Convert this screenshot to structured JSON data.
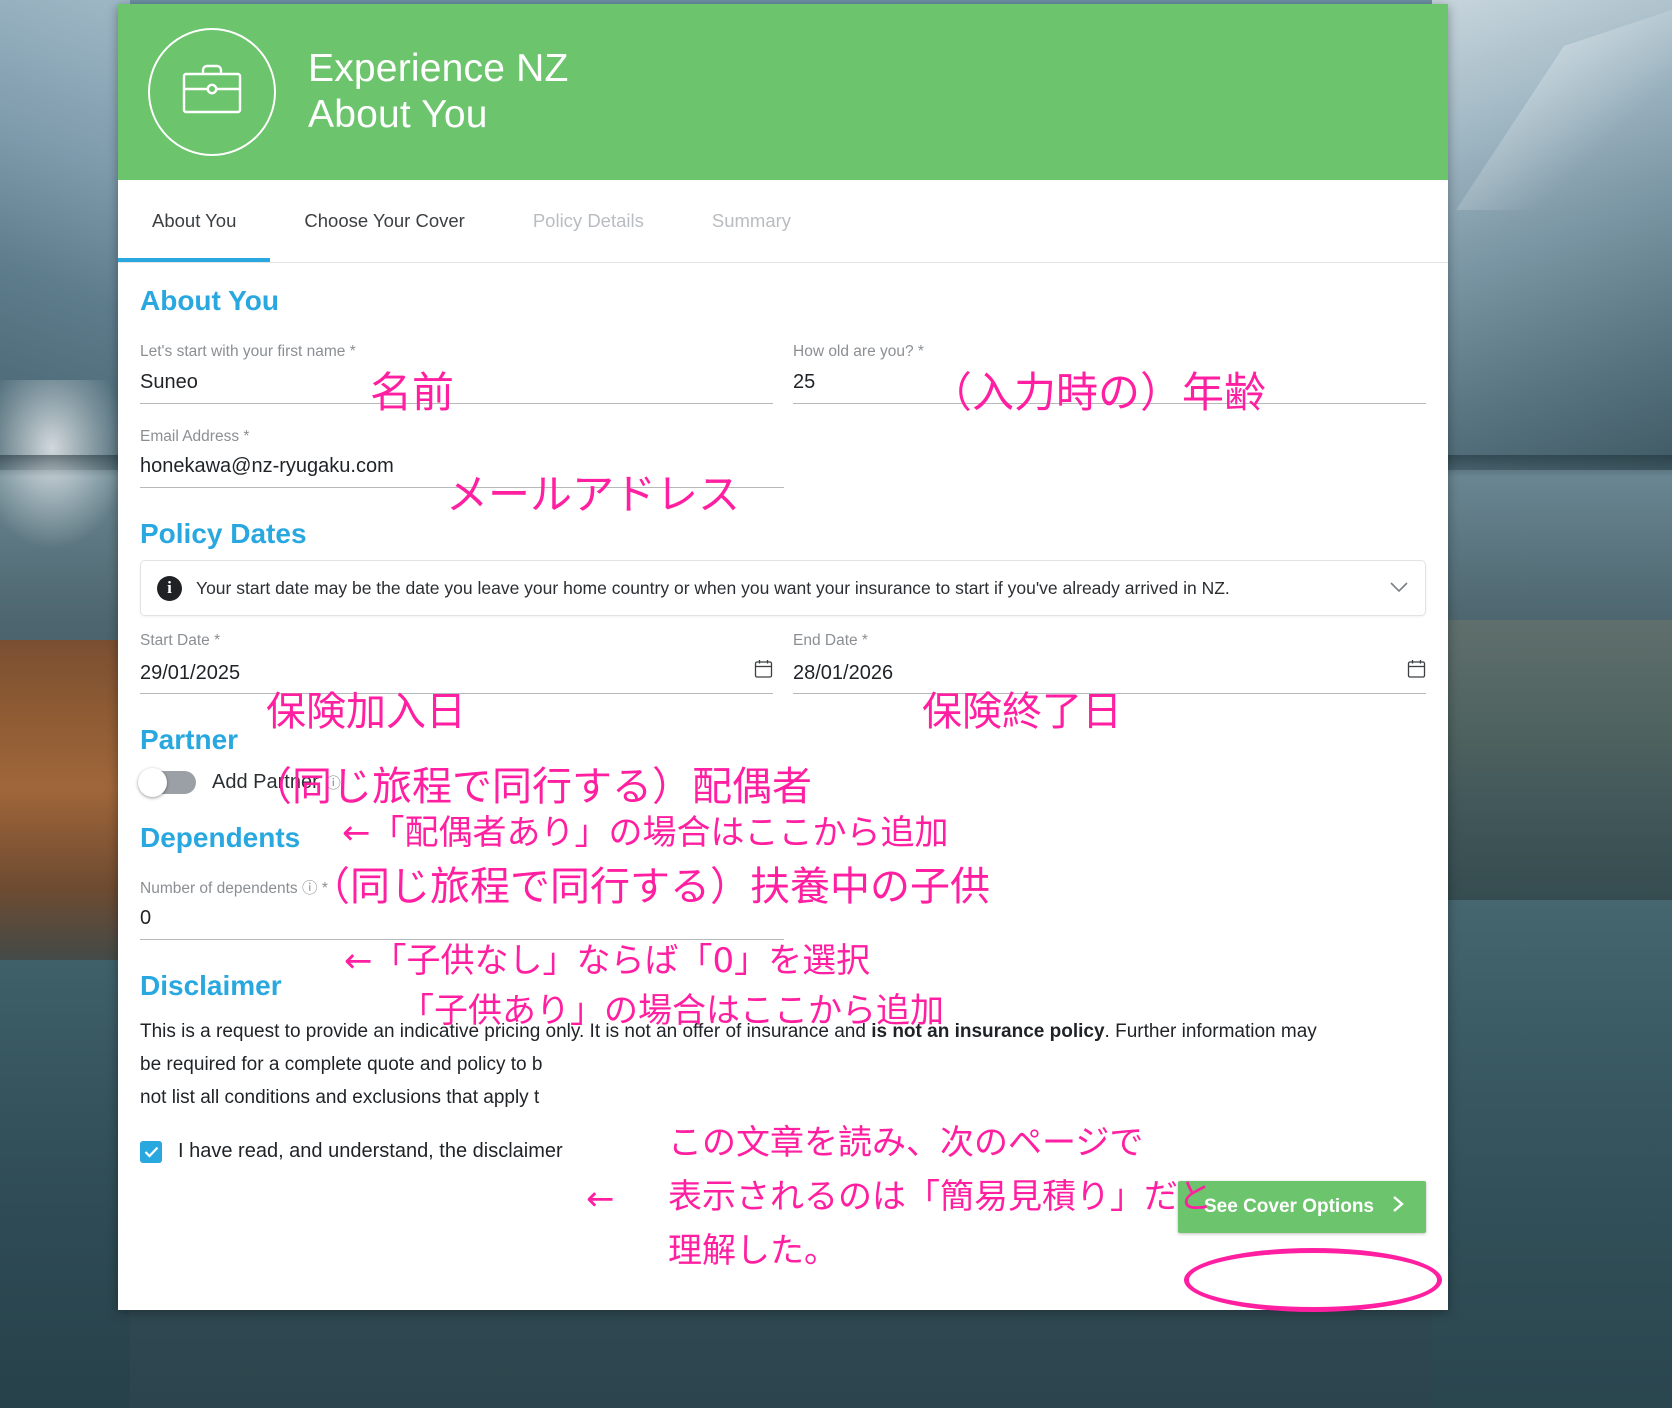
{
  "header": {
    "logo_icon": "briefcase-icon",
    "brand": "Experience NZ",
    "page": "About You",
    "bg_color": "#6cc46c"
  },
  "tabs": [
    {
      "label": "About You",
      "state": "active"
    },
    {
      "label": "Choose Your Cover",
      "state": "enabled"
    },
    {
      "label": "Policy Details",
      "state": "disabled"
    },
    {
      "label": "Summary",
      "state": "disabled"
    }
  ],
  "sections": {
    "about_you": {
      "title": "About You",
      "first_name": {
        "label": "Let's start with your first name *",
        "value": "Suneo"
      },
      "age": {
        "label": "How old are you? *",
        "value": "25"
      },
      "email": {
        "label": "Email Address *",
        "value": "honekawa@nz-ryugaku.com"
      }
    },
    "policy_dates": {
      "title": "Policy Dates",
      "info": {
        "icon": "info-icon",
        "text": "Your start date may be the date you leave your home country or when you want your insurance to start if you've already arrived in NZ.",
        "chevron": "chevron-down-icon"
      },
      "start_date": {
        "label": "Start Date *",
        "value": "29/01/2025"
      },
      "end_date": {
        "label": "End Date *",
        "value": "28/01/2026"
      }
    },
    "partner": {
      "title": "Partner",
      "toggle_label": "Add Partner",
      "toggle_state": "off",
      "help": "?"
    },
    "dependents": {
      "title": "Dependents",
      "label": "Number of dependents ⑦ *",
      "label_text": "Number of dependents",
      "help": "?",
      "required_mark": "*",
      "value": "0"
    },
    "disclaimer": {
      "title": "Disclaimer",
      "line1_a": "This is a request to provide an indicative pricing only. It is not an offer of insurance and ",
      "line1_bold": "is not an insurance policy",
      "line1_b": ". Further information may",
      "line2": "be required for a complete quote and policy to b",
      "line3": "not list all conditions and exclusions that apply t",
      "checkbox_checked": true,
      "checkbox_label": "I have read, and understand, the disclaimer"
    }
  },
  "footer": {
    "cover_button": "See Cover Options",
    "cover_button_arrow": "chevron-right-icon"
  },
  "annotations": {
    "color": "#ff1fa0",
    "name": "名前",
    "age": "（入力時の）年齢",
    "email": "メールアドレス",
    "start_date": "保険加入日",
    "end_date": "保険終了日",
    "partner": "（同じ旅程で同行する）配偶者",
    "partner_arrow": "←「配偶者あり」の場合はここから追加",
    "dependents": "（同じ旅程で同行する）扶養中の子供",
    "dependents_arrow1": "←「子供なし」ならば「0」を選択",
    "dependents_arrow2": "「子供あり」の場合はここから追加",
    "checkbox_arrow": "←",
    "disclaimer_note_l1": "この文章を読み、次のページで",
    "disclaimer_note_l2": "表示されるのは「簡易見積り」だと",
    "disclaimer_note_l3": "理解した。"
  }
}
